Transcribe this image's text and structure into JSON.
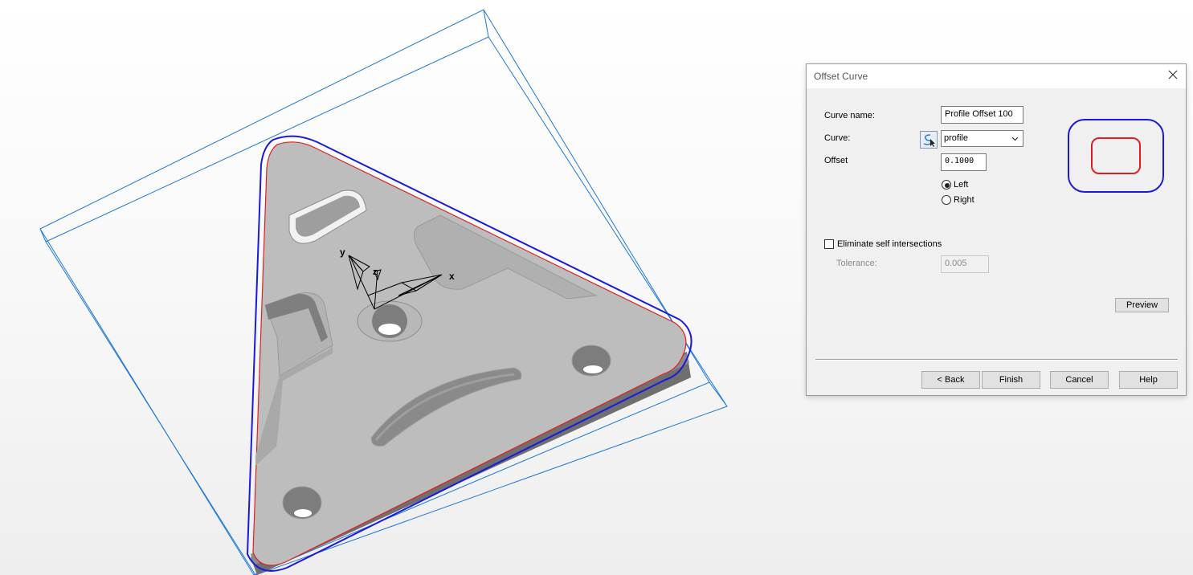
{
  "viewport": {
    "triad_labels": {
      "x": "x",
      "y": "y",
      "z": "z"
    },
    "colors": {
      "stock_outline": "#1e78d6",
      "offset_curve": "#1a1adb",
      "profile_curve": "#e02020",
      "part_face": "#bdbdbd",
      "part_side": "#6f6f6f"
    }
  },
  "dialog": {
    "title": "Offset Curve",
    "curve_name_label": "Curve name:",
    "curve_name_value": "Profile Offset 100",
    "curve_label": "Curve:",
    "curve_value": "profile",
    "offset_label": "Offset",
    "offset_value": "0.1000",
    "direction": {
      "left_label": "Left",
      "right_label": "Right",
      "selected": "Left"
    },
    "eliminate_label": "Eliminate self intersections",
    "eliminate_checked": false,
    "tolerance_label": "Tolerance:",
    "tolerance_value": "0.005",
    "preview_button": "Preview",
    "back_button": "< Back",
    "finish_button": "Finish",
    "cancel_button": "Cancel",
    "help_button": "Help",
    "preview_icon_colors": {
      "outer": "#1a1adb",
      "inner": "#e02020"
    }
  }
}
